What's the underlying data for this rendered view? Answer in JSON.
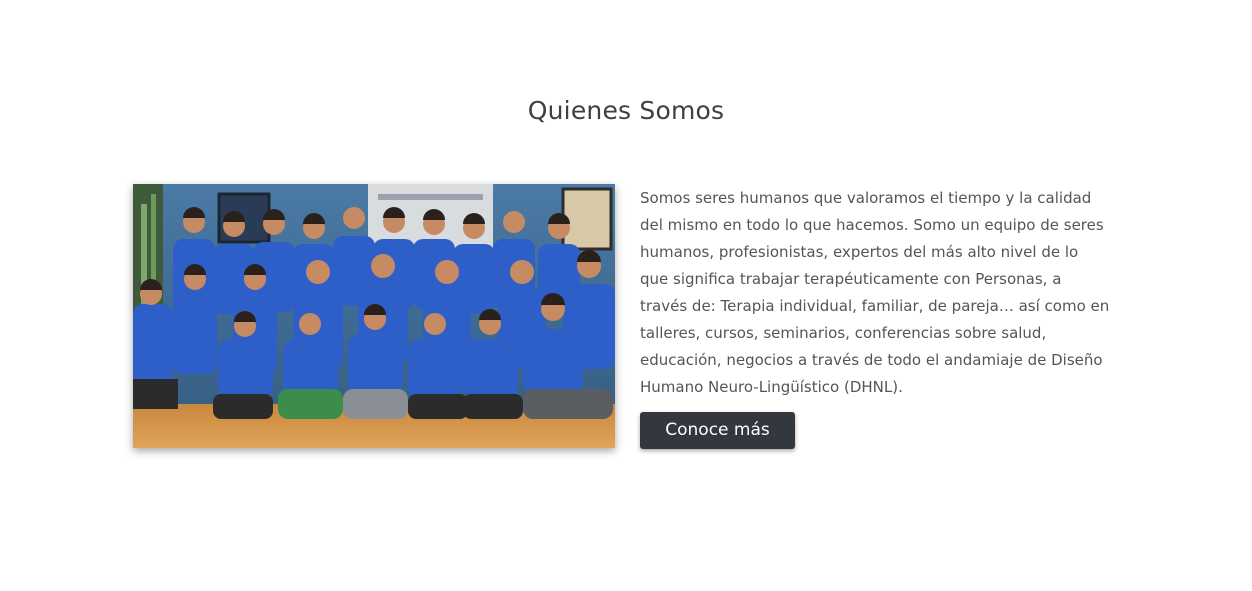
{
  "about": {
    "title": "Quienes Somos",
    "description": "Somos seres humanos que valoramos el tiempo y la calidad del mismo en todo lo que hacemos. Somo un equipo de seres humanos, profesionistas, expertos del más alto nivel de lo que significa trabajar terapéuticamente con Personas, a través de: Terapia individual, familiar, de pareja… así como en talleres, cursos, seminarios, conferencias sobre salud, educación, negocios a través de todo el andamiaje de Diseño Humano Neuro-Lingüístico (DHNL).",
    "button_label": "Conoce más"
  },
  "colors": {
    "button_bg": "#33383e",
    "shirt_blue": "#2e5fc9",
    "floor": "#d89a4e",
    "wall": "#3f6f98"
  }
}
